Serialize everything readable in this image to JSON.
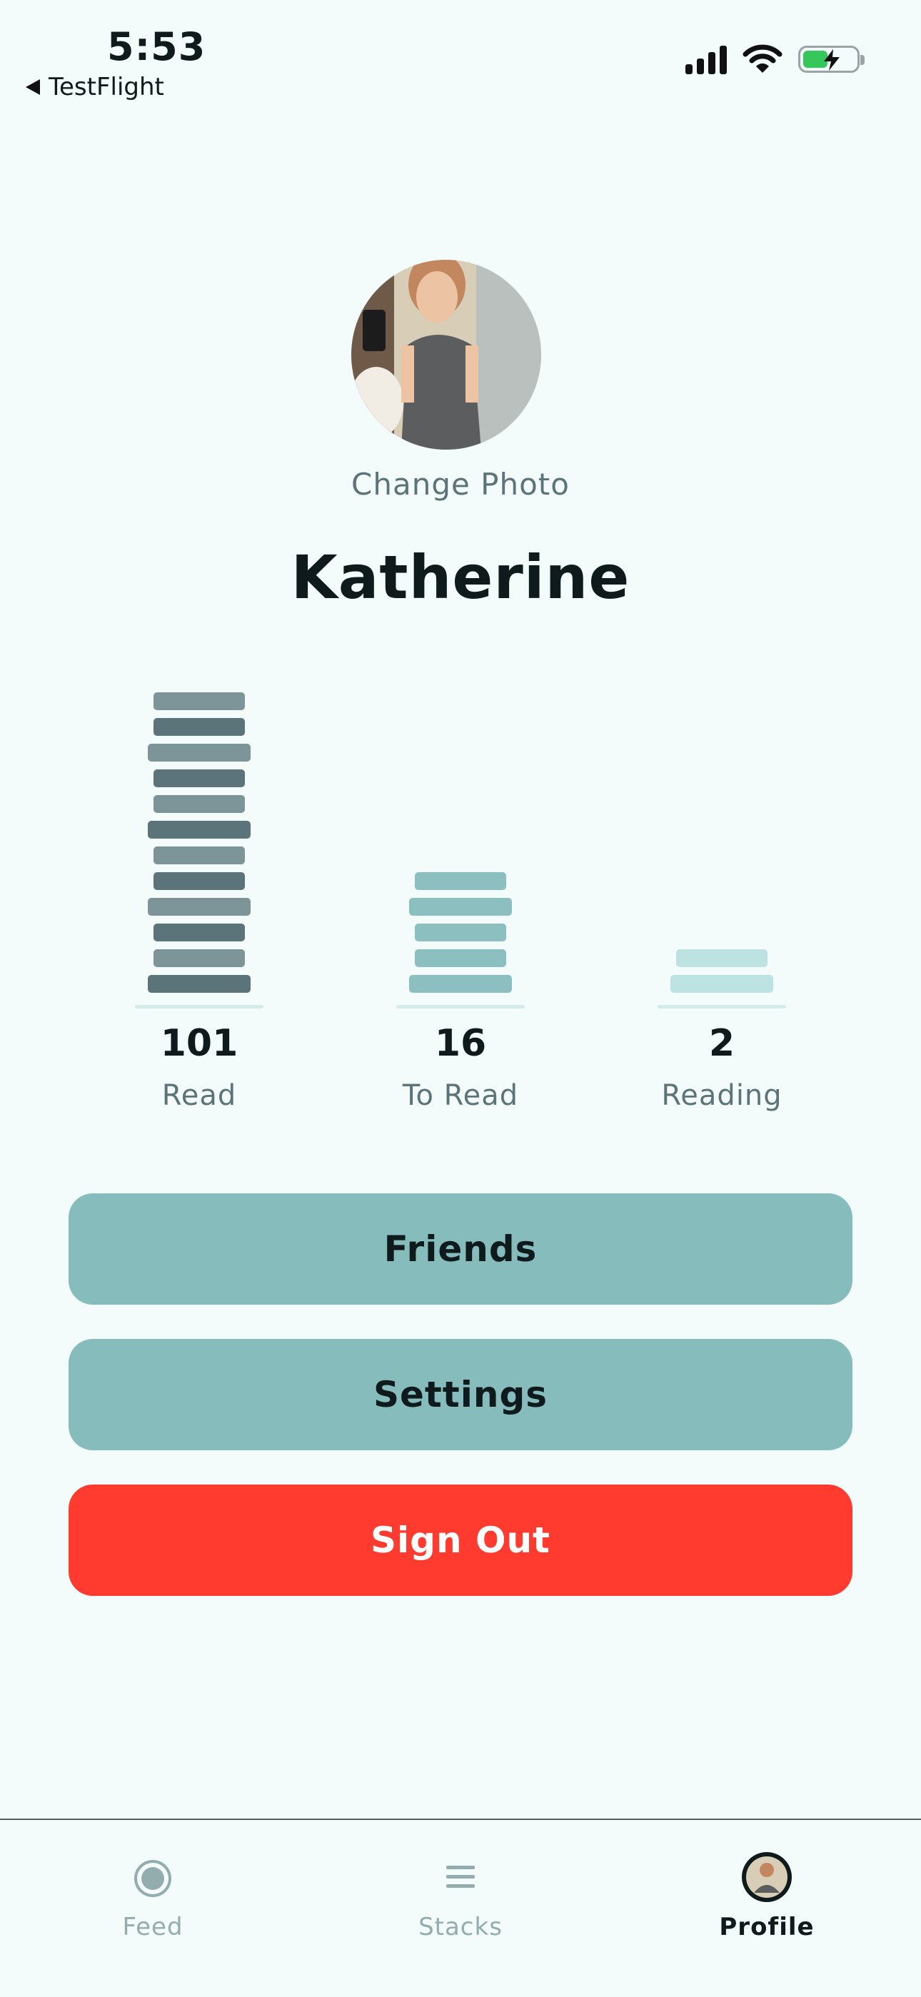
{
  "status_bar": {
    "time": "5:53",
    "back_label": "TestFlight"
  },
  "profile": {
    "change_photo_label": "Change Photo",
    "name": "Katherine"
  },
  "stats": [
    {
      "count": "101",
      "label": "Read"
    },
    {
      "count": "16",
      "label": "To Read"
    },
    {
      "count": "2",
      "label": "Reading"
    }
  ],
  "buttons": {
    "friends": "Friends",
    "settings": "Settings",
    "sign_out": "Sign Out"
  },
  "tab_bar": {
    "tabs": [
      {
        "label": "Feed",
        "icon": "feed-circle-icon",
        "active": false
      },
      {
        "label": "Stacks",
        "icon": "stacks-lines-icon",
        "active": false
      },
      {
        "label": "Profile",
        "icon": "profile-avatar-icon",
        "active": true
      }
    ]
  },
  "colors": {
    "background": "#F3FBFB",
    "read_stack_dark": "#5B7479",
    "read_stack_light": "#7D9499",
    "to_read_stack": "#8BBFC0",
    "reading_stack": "#BCE2E2",
    "button_teal": "#86BCBC",
    "button_red": "#FF3B30",
    "battery_green": "#35C759"
  }
}
